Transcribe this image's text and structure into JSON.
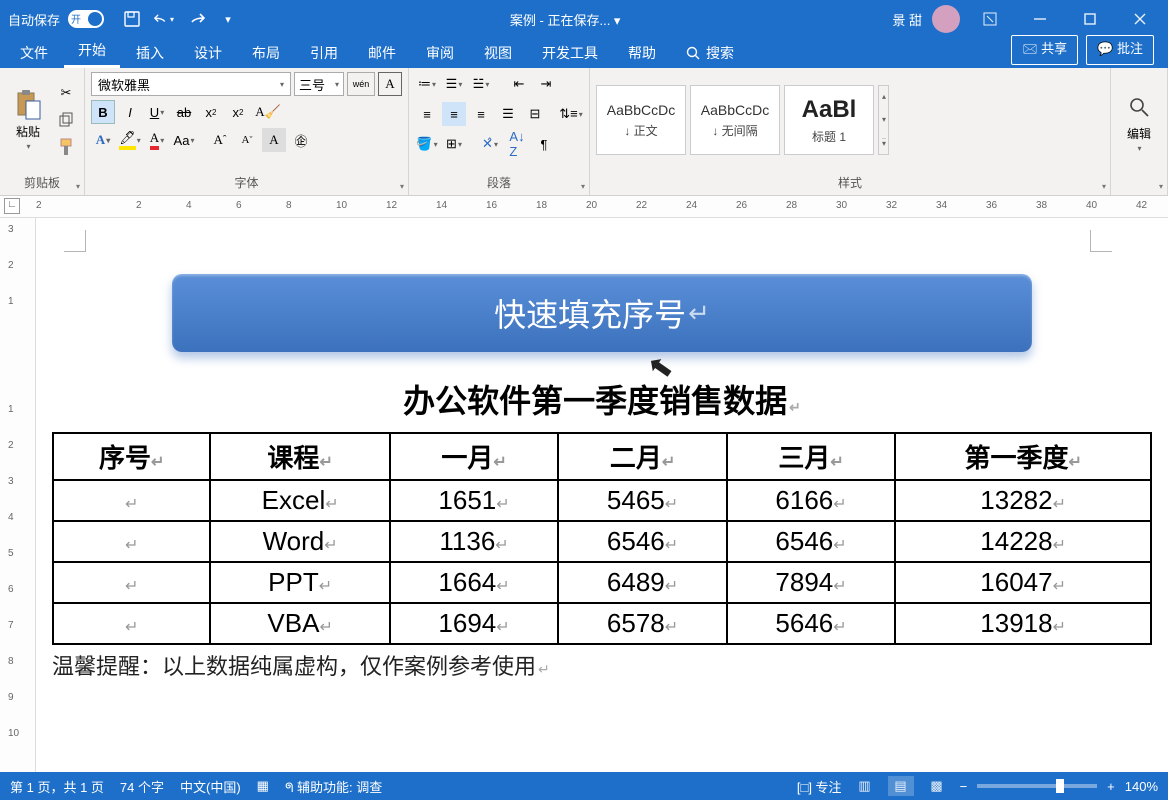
{
  "title_bar": {
    "autosave_label": "自动保存",
    "toggle_state": "开",
    "document_title": "案例 - 正在保存... ▾",
    "username": "景 甜"
  },
  "tabs": {
    "file": "文件",
    "home": "开始",
    "insert": "插入",
    "design": "设计",
    "layout": "布局",
    "references": "引用",
    "mailings": "邮件",
    "review": "审阅",
    "view": "视图",
    "developer": "开发工具",
    "help": "帮助",
    "search": "搜索",
    "share": "共享",
    "comments": "批注"
  },
  "ribbon": {
    "clipboard": {
      "paste": "粘贴",
      "label": "剪贴板"
    },
    "font": {
      "name": "微软雅黑",
      "size": "三号",
      "phonetic": "wén",
      "label": "字体"
    },
    "paragraph": {
      "label": "段落"
    },
    "styles": {
      "label": "样式",
      "items": [
        {
          "preview": "AaBbCcDc",
          "name": "↓ 正文"
        },
        {
          "preview": "AaBbCcDc",
          "name": "↓ 无间隔"
        },
        {
          "preview": "AaBl",
          "name": "标题 1"
        }
      ]
    },
    "editing": {
      "label": "编辑"
    }
  },
  "document": {
    "banner": "快速填充序号",
    "heading": "办公软件第一季度销售数据",
    "table": {
      "headers": [
        "序号",
        "课程",
        "一月",
        "二月",
        "三月",
        "第一季度"
      ],
      "rows": [
        [
          "",
          "Excel",
          "1651",
          "5465",
          "6166",
          "13282"
        ],
        [
          "",
          "Word",
          "1136",
          "6546",
          "6546",
          "14228"
        ],
        [
          "",
          "PPT",
          "1664",
          "6489",
          "7894",
          "16047"
        ],
        [
          "",
          "VBA",
          "1694",
          "6578",
          "5646",
          "13918"
        ]
      ]
    },
    "note": "温馨提醒：以上数据纯属虚构，仅作案例参考使用"
  },
  "status": {
    "page": "第 1 页，共 1 页",
    "words": "74 个字",
    "language": "中文(中国)",
    "accessibility": "辅助功能: 调查",
    "focus": "专注",
    "zoom": "140%"
  },
  "ruler": {
    "h": [
      "2",
      "",
      "2",
      "4",
      "6",
      "8",
      "10",
      "12",
      "14",
      "16",
      "18",
      "20",
      "22",
      "24",
      "26",
      "28",
      "30",
      "32",
      "34",
      "36",
      "38",
      "40",
      "42"
    ],
    "v": [
      "3",
      "2",
      "1",
      "",
      "",
      "1",
      "2",
      "3",
      "4",
      "5",
      "6",
      "7",
      "8",
      "9",
      "10"
    ]
  }
}
